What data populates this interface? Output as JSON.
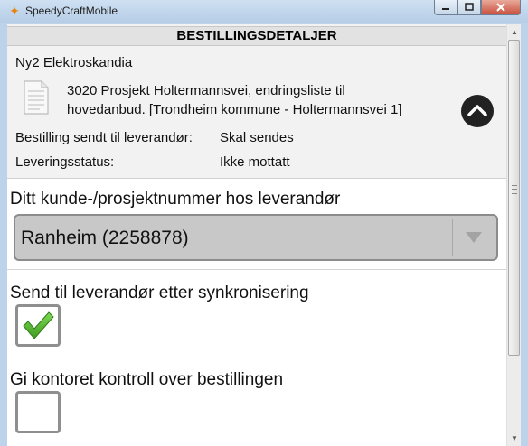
{
  "window": {
    "title": "SpeedyCraftMobile",
    "icon": "app-star-icon"
  },
  "header": {
    "title": "BESTILLINGSDETALJER"
  },
  "summary": {
    "supplier": "Ny2 Elektroskandia",
    "description_line1": "3020 Prosjekt Holtermannsvei, endringsliste til",
    "description_line2": "hovedanbud. [Trondheim kommune - Holtermannsvei 1]",
    "order_sent_label": "Bestilling sendt til leverandør:",
    "order_sent_value": "Skal sendes",
    "delivery_status_label": "Leveringsstatus:",
    "delivery_status_value": "Ikke mottatt"
  },
  "customer_number": {
    "label": "Ditt kunde-/prosjektnummer hos leverandør",
    "selected": "Ranheim (2258878)"
  },
  "send_after_sync": {
    "label": "Send til leverandør etter synkronisering",
    "checked": true
  },
  "office_control": {
    "label": "Gi kontoret kontroll over bestillingen",
    "checked": false
  },
  "colors": {
    "check_green": "#4cae2a",
    "accent_dark": "#1f1f1f"
  }
}
